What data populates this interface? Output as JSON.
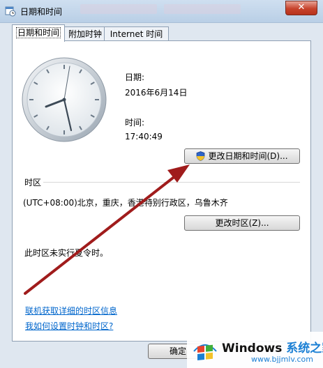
{
  "window": {
    "title": "日期和时间",
    "close_glyph": "✕"
  },
  "tabs": [
    {
      "label": "日期和时间",
      "active": true
    },
    {
      "label": "附加时钟",
      "active": false
    },
    {
      "label": "Internet 时间",
      "active": false
    }
  ],
  "date_section": {
    "date_label": "日期:",
    "date_value": "2016年6月14日",
    "time_label": "时间:",
    "time_value": "17:40:49",
    "change_datetime_button": "更改日期和时间(D)..."
  },
  "timezone_section": {
    "heading": "时区",
    "timezone_value": "(UTC+08:00)北京，重庆，香港特别行政区，乌鲁木齐",
    "change_timezone_button": "更改时区(Z)...",
    "dst_notice": "此时区未实行夏令时。"
  },
  "links": {
    "online_info": "联机获取详细的时区信息",
    "how_to_set": "我如何设置时钟和时区?"
  },
  "footer": {
    "ok_button": "确定"
  },
  "watermark": {
    "brand": "Windows",
    "brand_suffix": "系统之家",
    "url": "www.bjjmlv.com"
  },
  "colors": {
    "arrow": "#a01c1c",
    "link": "#0066cc"
  }
}
